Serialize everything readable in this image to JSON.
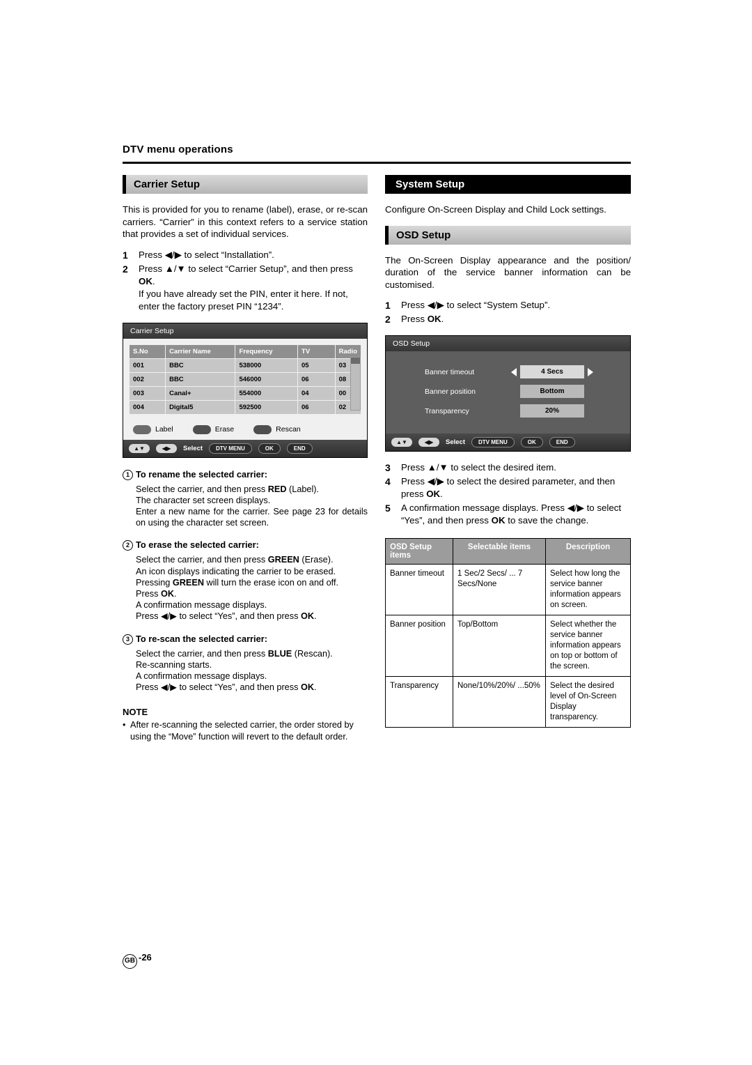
{
  "header": {
    "title": "DTV menu operations"
  },
  "left": {
    "section_title": "Carrier Setup",
    "intro": "This is provided for you to rename (label), erase, or re-scan carriers. “Carrier” in this context refers to a service station that provides a set of individual services.",
    "steps": [
      {
        "num": "1",
        "text_a": "Press ",
        "arrows": "◀/▶",
        "text_b": " to select “Installation”."
      },
      {
        "num": "2",
        "text_a": "Press ",
        "arrows": "▲/▼",
        "text_b": " to select “Carrier Setup”, and then press ",
        "bold": "OK",
        "text_c": ".",
        "extra": "If you have already set the PIN, enter it here. If not, enter the factory preset PIN “1234”."
      }
    ],
    "osd": {
      "title": "Carrier Setup",
      "columns": [
        "S.No",
        "Carrier Name",
        "Frequency",
        "TV",
        "Radio"
      ],
      "rows": [
        [
          "001",
          "BBC",
          "538000",
          "05",
          "03"
        ],
        [
          "002",
          "BBC",
          "546000",
          "06",
          "08"
        ],
        [
          "003",
          "Canal+",
          "554000",
          "04",
          "00"
        ],
        [
          "004",
          "Digital5",
          "592500",
          "06",
          "02"
        ]
      ],
      "color_buttons": [
        "Label",
        "Erase",
        "Rescan"
      ],
      "footer": {
        "select": "Select",
        "dtv_menu": "DTV MENU",
        "ok": "OK",
        "end": "END"
      }
    },
    "items": [
      {
        "n": "1",
        "title": "To rename the selected carrier:",
        "body": "Select the carrier, and then press RED (Label). The character set screen displays.\nEnter a new name for the carrier. See page 23 for details on using the character set screen.",
        "lines": [
          {
            "pre": "Select the carrier, and then press ",
            "bold": "RED",
            "post": " (Label)."
          },
          {
            "pre": "The character set screen displays.",
            "bold": "",
            "post": ""
          },
          {
            "pre": "Enter a new name for the carrier. See page 23 for details on using the character set screen.",
            "bold": "",
            "post": ""
          }
        ]
      },
      {
        "n": "2",
        "title": "To erase the selected carrier:",
        "lines": [
          {
            "pre": "Select the carrier, and then press ",
            "bold": "GREEN",
            "post": " (Erase)."
          },
          {
            "pre": "An icon displays indicating the carrier to be erased.",
            "bold": "",
            "post": ""
          },
          {
            "pre": "Pressing ",
            "bold": "GREEN",
            "post": " will turn the erase icon on and off."
          },
          {
            "pre": "Press ",
            "bold": "OK",
            "post": "."
          },
          {
            "pre": "A confirmation message displays.",
            "bold": "",
            "post": ""
          },
          {
            "pre": "Press ◀/▶ to select “Yes”, and then press ",
            "bold": "OK",
            "post": "."
          }
        ]
      },
      {
        "n": "3",
        "title": "To re-scan the selected carrier:",
        "lines": [
          {
            "pre": "Select the carrier, and then press ",
            "bold": "BLUE",
            "post": " (Rescan)."
          },
          {
            "pre": "Re-scanning starts.",
            "bold": "",
            "post": ""
          },
          {
            "pre": "A confirmation message displays.",
            "bold": "",
            "post": ""
          },
          {
            "pre": "Press ◀/▶ to select “Yes”, and then press ",
            "bold": "OK",
            "post": "."
          }
        ]
      }
    ],
    "note": {
      "title": "NOTE",
      "bullet": "•",
      "text": "After re-scanning the selected carrier, the order stored by using the “Move” function will revert to the default order."
    }
  },
  "right": {
    "section_title": "System Setup",
    "intro": "Configure On-Screen Display and Child Lock settings.",
    "sub_title": "OSD Setup",
    "sub_intro": "The On-Screen Display appearance and the position/ duration of the service banner information can be customised.",
    "steps_top": [
      {
        "num": "1",
        "text_a": "Press ",
        "arrows": "◀/▶",
        "text_b": " to select “System Setup”."
      },
      {
        "num": "2",
        "text_a": "Press ",
        "bold": "OK",
        "text_b": "."
      }
    ],
    "osd": {
      "title": "OSD Setup",
      "rows": [
        {
          "label": "Banner timeout",
          "value": "4 Secs",
          "selected": true
        },
        {
          "label": "Banner position",
          "value": "Bottom",
          "selected": false
        },
        {
          "label": "Transparency",
          "value": "20%",
          "selected": false
        }
      ],
      "footer": {
        "select": "Select",
        "dtv_menu": "DTV MENU",
        "ok": "OK",
        "end": "END"
      }
    },
    "steps_bottom": [
      {
        "num": "3",
        "text_a": "Press ",
        "arrows": "▲/▼",
        "text_b": " to select the desired item."
      },
      {
        "num": "4",
        "text_a": "Press ",
        "arrows": "◀/▶",
        "text_b": " to select the desired parameter, and then press ",
        "bold": "OK",
        "text_c": "."
      },
      {
        "num": "5",
        "text_a": "A confirmation message displays. Press ",
        "arrows": "◀/▶",
        "text_b": " to select “Yes”, and then press ",
        "bold": "OK",
        "text_c": " to save the change."
      }
    ],
    "table": {
      "headers": [
        "OSD Setup items",
        "Selectable items",
        "Description"
      ],
      "rows": [
        [
          "Banner timeout",
          "1 Sec/2 Secs/ ... 7 Secs/None",
          "Select how long the service banner information appears on screen."
        ],
        [
          "Banner position",
          "Top/Bottom",
          "Select whether the service banner information appears on top or bottom of the screen."
        ],
        [
          "Transparency",
          "None/10%/20%/ ...50%",
          "Select the desired level of On-Screen Display transparency."
        ]
      ]
    }
  },
  "footer": {
    "gb": "GB",
    "page": "-26"
  }
}
